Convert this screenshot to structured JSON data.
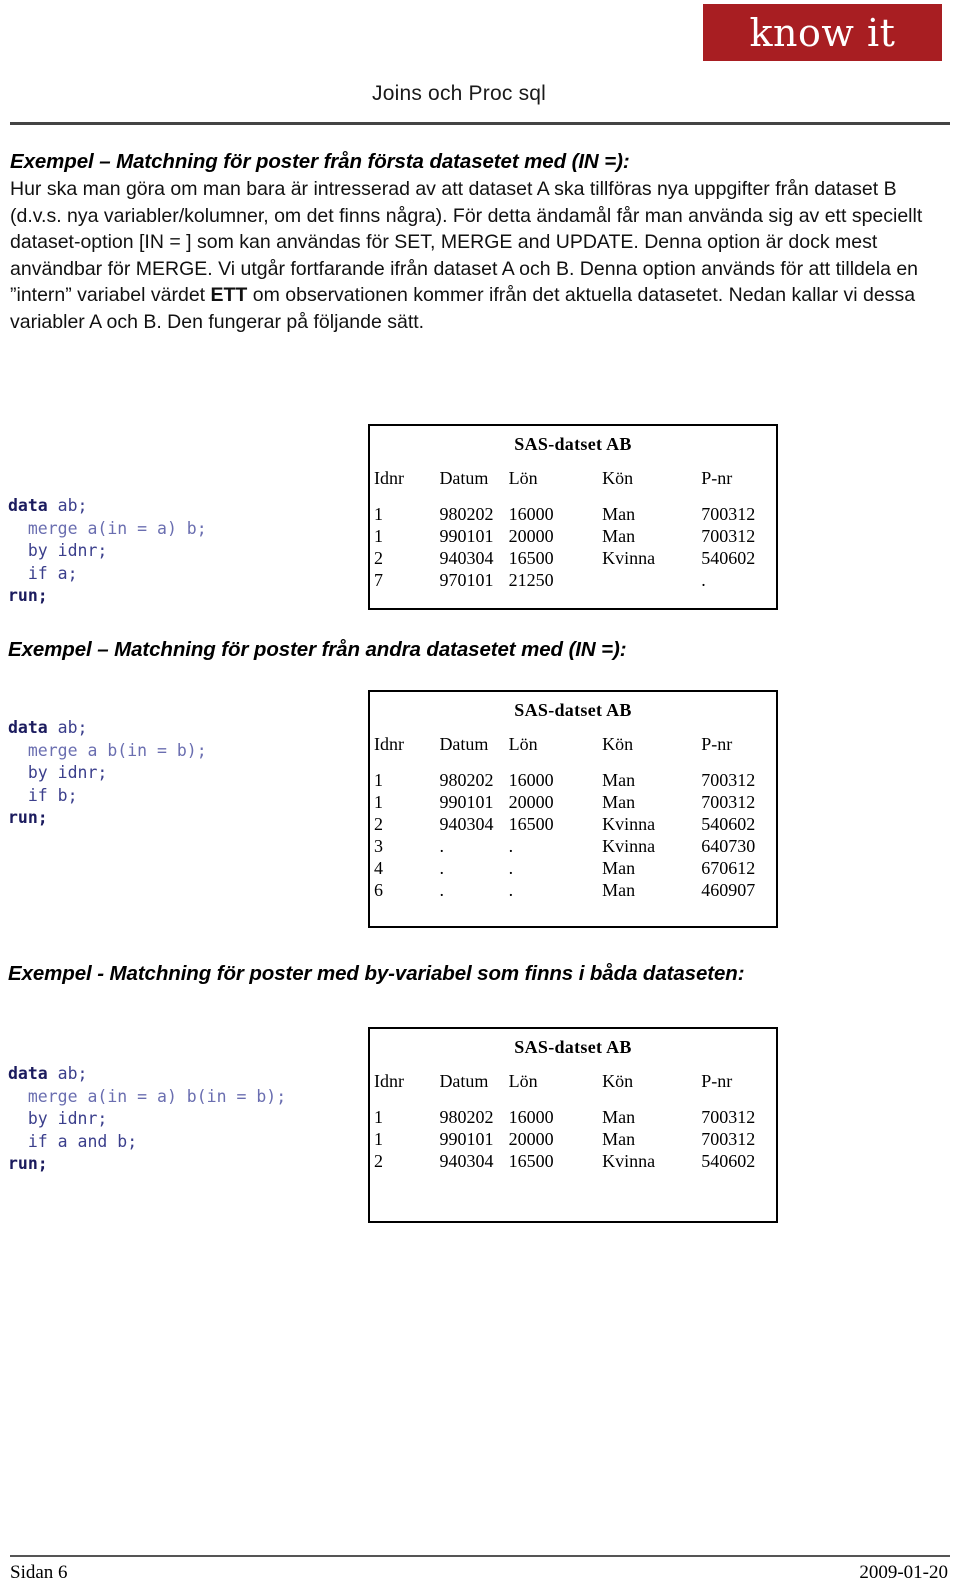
{
  "header": {
    "logo_text": "know it",
    "logo_color": "#A81E22",
    "doc_title": "Joins och Proc sql"
  },
  "body": {
    "intro_heading": "Exempel – Matchning för poster från första datasetet med (IN =):",
    "intro_paragraph_part1": "Hur ska man göra om man bara är intresserad av att dataset A ska tillföras nya uppgifter från dataset B (d.v.s. nya variabler/kolumner, om det finns några). För detta ändamål får man använda sig av ett speciellt dataset-option [IN = ] som kan användas för SET, MERGE and UPDATE. Denna option är dock mest användbar för MERGE. Vi utgår fortfarande ifrån dataset A och B. Denna option används för att tilldela en ”intern” variabel värdet ",
    "intro_paragraph_emphasis": "ETT",
    "intro_paragraph_part2": " om observationen kommer ifrån det aktuella datasetet. Nedan kallar vi dessa variabler A och B. Den fungerar på följande sätt.",
    "heading_2": "Exempel – Matchning för poster från andra datasetet med (IN =):",
    "heading_3": "Exempel - Matchning för poster med by-variabel som finns i båda dataseten:"
  },
  "code_blocks": {
    "block1": {
      "line1_kw": "data",
      "line1_rest": " ab;",
      "line2": "  merge a(in = a) b;",
      "line3": "  by idnr;",
      "line4": "  if a;",
      "line5_kw": "run;"
    },
    "block2": {
      "line1_kw": "data",
      "line1_rest": " ab;",
      "line2": "  merge a b(in = b);",
      "line3": "  by idnr;",
      "line4": "  if b;",
      "line5_kw": "run;"
    },
    "block3": {
      "line1_kw": "data",
      "line1_rest": " ab;",
      "line2": "  merge a(in = a) b(in = b);",
      "line3": "  by idnr;",
      "line4": "  if a and b;",
      "line5_kw": "run;"
    }
  },
  "tables": [
    {
      "title": "SAS-datset AB",
      "columns": [
        "Idnr",
        "Datum",
        "Lön",
        "Kön",
        "P-nr"
      ],
      "rows": [
        [
          "1",
          "980202",
          "16000",
          "Man",
          "700312"
        ],
        [
          "1",
          "990101",
          "20000",
          "Man",
          "700312"
        ],
        [
          "2",
          "940304",
          "16500",
          "Kvinna",
          "540602"
        ],
        [
          "7",
          "970101",
          "21250",
          "",
          "."
        ]
      ]
    },
    {
      "title": "SAS-datset AB",
      "columns": [
        "Idnr",
        "Datum",
        "Lön",
        "Kön",
        "P-nr"
      ],
      "rows": [
        [
          "1",
          "980202",
          "16000",
          "Man",
          "700312"
        ],
        [
          "1",
          "990101",
          "20000",
          "Man",
          "700312"
        ],
        [
          "2",
          "940304",
          "16500",
          "Kvinna",
          "540602"
        ],
        [
          "3",
          ".",
          ".",
          "Kvinna",
          "640730"
        ],
        [
          "4",
          ".",
          ".",
          "Man",
          "670612"
        ],
        [
          "6",
          ".",
          ".",
          "Man",
          "460907"
        ]
      ]
    },
    {
      "title": "SAS-datset AB",
      "columns": [
        "Idnr",
        "Datum",
        "Lön",
        "Kön",
        "P-nr"
      ],
      "rows": [
        [
          "1",
          "980202",
          "16000",
          "Man",
          "700312"
        ],
        [
          "1",
          "990101",
          "20000",
          "Man",
          "700312"
        ],
        [
          "2",
          "940304",
          "16500",
          "Kvinna",
          "540602"
        ]
      ]
    }
  ],
  "footer": {
    "page_label": "Sidan 6",
    "date": "2009-01-20"
  }
}
